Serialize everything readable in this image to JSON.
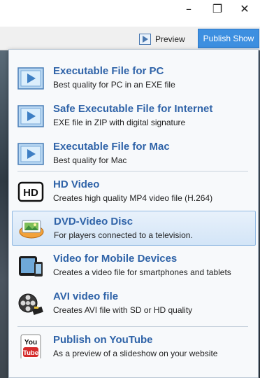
{
  "window": {
    "controls": {
      "minimize": "–",
      "maximize": "❐",
      "close": "✕"
    }
  },
  "toolbar": {
    "preview_label": "Preview",
    "preview_icon": "preview-play-icon",
    "publish_label": "Publish Show",
    "publish_color": "#3d8fe0"
  },
  "menu": {
    "items": [
      {
        "title": "Executable File for PC",
        "description": "Best quality for PC in an EXE file",
        "icon": "exe-play-icon"
      },
      {
        "title": "Safe Executable File for Internet",
        "description": "EXE file in ZIP with digital signature",
        "icon": "exe-play-icon"
      },
      {
        "title": "Executable File for Mac",
        "description": "Best quality for Mac",
        "icon": "exe-play-icon"
      },
      {
        "title": "HD Video",
        "description": "Creates high quality MP4 video file (H.264)",
        "icon": "hd-icon",
        "icon_text": "HD"
      },
      {
        "title": "DVD-Video Disc",
        "description": "For players connected to a television.",
        "icon": "dvd-disc-icon",
        "selected": true
      },
      {
        "title": "Video for Mobile Devices",
        "description": "Creates a video file for smartphones and tablets",
        "icon": "mobile-devices-icon"
      },
      {
        "title": "AVI video file",
        "description": "Creates AVI file with SD or HD quality",
        "icon": "film-reel-icon"
      },
      {
        "title": "Publish on YouTube",
        "description": "As a preview of a slideshow on your website",
        "icon": "youtube-icon",
        "icon_text_top": "You",
        "icon_text_bottom": "Tube"
      }
    ]
  },
  "colors": {
    "title_text": "#2f63a8",
    "selected_bg": "#d3e5f7",
    "selected_border": "#90b8e2"
  }
}
